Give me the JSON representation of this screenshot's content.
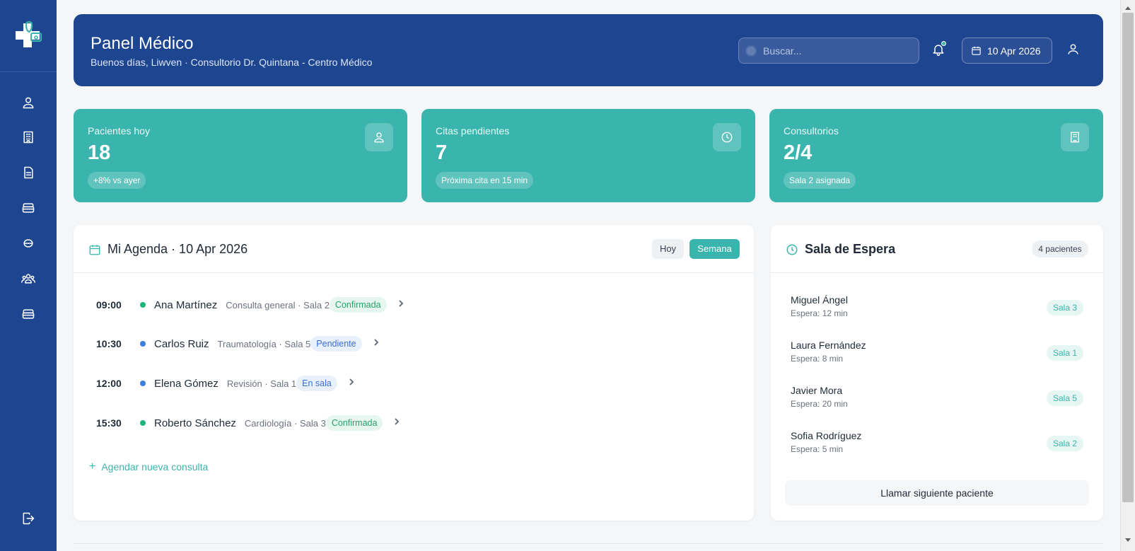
{
  "header": {
    "title": "Panel Médico",
    "subtitle": "Buenos días, Liwven · Consultorio Dr. Quintana - Centro Médico",
    "search_placeholder": "Buscar...",
    "date": "10 Apr 2026"
  },
  "sidebar": {
    "items": [
      {
        "icon": "user-icon"
      },
      {
        "icon": "building-icon"
      },
      {
        "icon": "document-icon"
      },
      {
        "icon": "bed-icon"
      },
      {
        "icon": "pill-icon"
      },
      {
        "icon": "users-icon"
      },
      {
        "icon": "bed-icon"
      }
    ],
    "logout_icon": "logout-icon"
  },
  "stats": [
    {
      "label": "Pacientes hoy",
      "value": "18",
      "pill": "+8% vs ayer",
      "icon": "user-icon"
    },
    {
      "label": "Citas pendientes",
      "value": "7",
      "pill": "Próxima cita en 15 min",
      "icon": "clock-icon"
    },
    {
      "label": "Consultorios",
      "value": "2/4",
      "pill": "Sala 2 asignada",
      "icon": "building-icon"
    }
  ],
  "agenda": {
    "title": "Mi Agenda · 10 Apr 2026",
    "btn_today": "Hoy",
    "btn_week": "Semana",
    "appointments": [
      {
        "time": "09:00",
        "name": "Ana Martínez",
        "meta": "Consulta general · Sala 2",
        "status": "Confirmada",
        "dot": "#1fb57a"
      },
      {
        "time": "10:30",
        "name": "Carlos Ruiz",
        "meta": "Traumatología · Sala 5",
        "status": "Pendiente",
        "dot": "#3a7ee0"
      },
      {
        "time": "12:00",
        "name": "Elena Gómez",
        "meta": "Revisión · Sala 1",
        "status": "En sala",
        "dot": "#3a7ee0"
      },
      {
        "time": "15:30",
        "name": "Roberto Sánchez",
        "meta": "Cardiología · Sala 3",
        "status": "Confirmada",
        "dot": "#1fb57a"
      }
    ],
    "new_appointment": "Agendar nueva consulta"
  },
  "waiting_room": {
    "title": "Sala de Espera",
    "count": "4 pacientes",
    "patients": [
      {
        "name": "Miguel Ángel",
        "wait": "Espera: 12 min",
        "room": "Sala 3"
      },
      {
        "name": "Laura Fernández",
        "wait": "Espera: 8 min",
        "room": "Sala 1"
      },
      {
        "name": "Javier Mora",
        "wait": "Espera: 20 min",
        "room": "Sala 5"
      },
      {
        "name": "Sofia Rodríguez",
        "wait": "Espera: 5 min",
        "room": "Sala 2"
      }
    ],
    "call_next": "Llamar siguiente paciente"
  },
  "colors": {
    "primary": "#1e4590",
    "accent": "#3ab5ad",
    "confirmed": "#26a26b",
    "pending": "#3a6fd8"
  }
}
